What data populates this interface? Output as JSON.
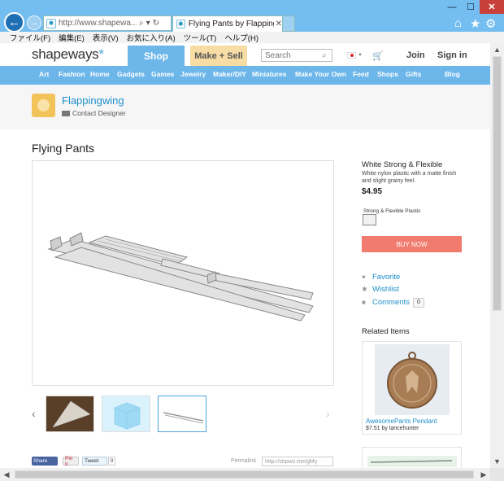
{
  "browser": {
    "url": "http://www.shapewa...",
    "tab_title": "Flying Pants by Flapping...",
    "menu": [
      "ファイル(F)",
      "編集(E)",
      "表示(V)",
      "お気に入り(A)",
      "ツール(T)",
      "ヘルプ(H)"
    ]
  },
  "site": {
    "logo": "shapeways",
    "logo_mark": "*",
    "shop_label": "Shop",
    "make_sell_label": "Make + Sell",
    "search_placeholder": "Search",
    "join_label": "Join",
    "signin_label": "Sign in"
  },
  "categories": [
    "Art",
    "Fashion",
    "Home",
    "Gadgets",
    "Games",
    "Jewelry",
    "Maker/DIY",
    "Miniatures",
    "Make Your Own",
    "Feed",
    "Shops",
    "Gifts",
    "Blog"
  ],
  "designer": {
    "name": "Flappingwing",
    "contact_label": "Contact Designer"
  },
  "product": {
    "title": "Flying Pants",
    "material_name": "White Strong & Flexible",
    "material_desc": "White nylon plastic with a matte finish and slight grainy feel.",
    "price": "$4.95",
    "swatch_label": "Strong & Flexible Plastic",
    "buy_label": "BUY NOW",
    "favorite_label": "Favorite",
    "wishlist_label": "Wishlist",
    "comments_label": "Comments",
    "comments_count": "0"
  },
  "share": {
    "fb_label": "Share",
    "pin_label": "Pin it",
    "tweet_label": "Tweet",
    "tweet_count": "0",
    "permalink_label": "Permalink",
    "permalink_value": "http://shpws.me/gMy"
  },
  "related": {
    "title": "Related Items",
    "item_name": "AwesomePants Pendant",
    "item_price": "$7.51",
    "item_by": "by",
    "item_author": "lancehunter"
  },
  "colors": {
    "accent_blue": "#6cb6ea",
    "buy_button": "#f17b6f",
    "make_sell": "#f7dca4",
    "link": "#1d8fc9"
  }
}
